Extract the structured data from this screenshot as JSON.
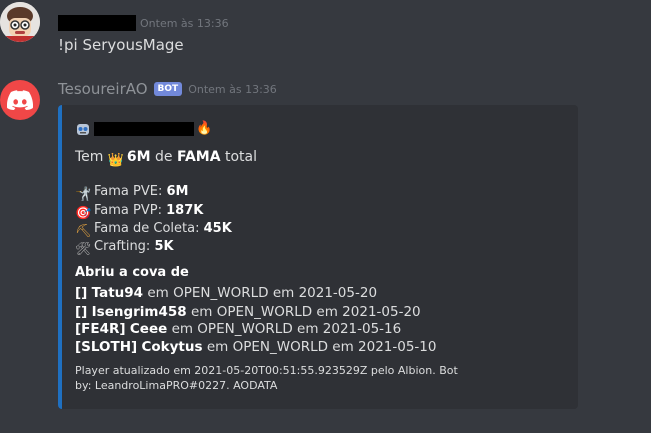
{
  "message1": {
    "time": "Ontem às 13:36",
    "content": "!pi SeryousMage"
  },
  "message2": {
    "author": "TesoureirAO",
    "bot_tag": "BOT",
    "time": "Ontem às 13:36"
  },
  "embed": {
    "accent": "#1f70c1",
    "fire_emoji": "🔥",
    "fama_line": {
      "prefix": "Tem",
      "crown": "👑",
      "value": "6M",
      "de": "de",
      "keyword": "FAMA",
      "suffix": "total"
    },
    "stats": [
      {
        "icon": "🤺",
        "label": "Fama PVE:",
        "value": "6M"
      },
      {
        "icon": "🎯",
        "label": "Fama PVP:",
        "value": "187K"
      },
      {
        "icon": "⛏",
        "label": "Fama de Coleta:",
        "value": "45K"
      },
      {
        "icon": "🛠",
        "label": "Crafting:",
        "value": "5K"
      }
    ],
    "cova_heading": "Abriu a cova de",
    "cova_entries": [
      {
        "guild": "[]",
        "name": "Tatu94",
        "rest": "em OPEN_WORLD em 2021-05-20"
      },
      {
        "guild": "[]",
        "name": "Isengrim458",
        "rest": "em OPEN_WORLD em 2021-05-20"
      },
      {
        "guild": "[FE4R]",
        "name": "Ceee",
        "rest": "em OPEN_WORLD em 2021-05-16"
      },
      {
        "guild": "[SLOTH]",
        "name": "Cokytus",
        "rest": "em OPEN_WORLD em 2021-05-10"
      }
    ],
    "footer": "Player atualizado em 2021-05-20T00:51:55.923529Z pelo Albion. Bot by: LeandroLimaPRO#0227. AODATA"
  }
}
